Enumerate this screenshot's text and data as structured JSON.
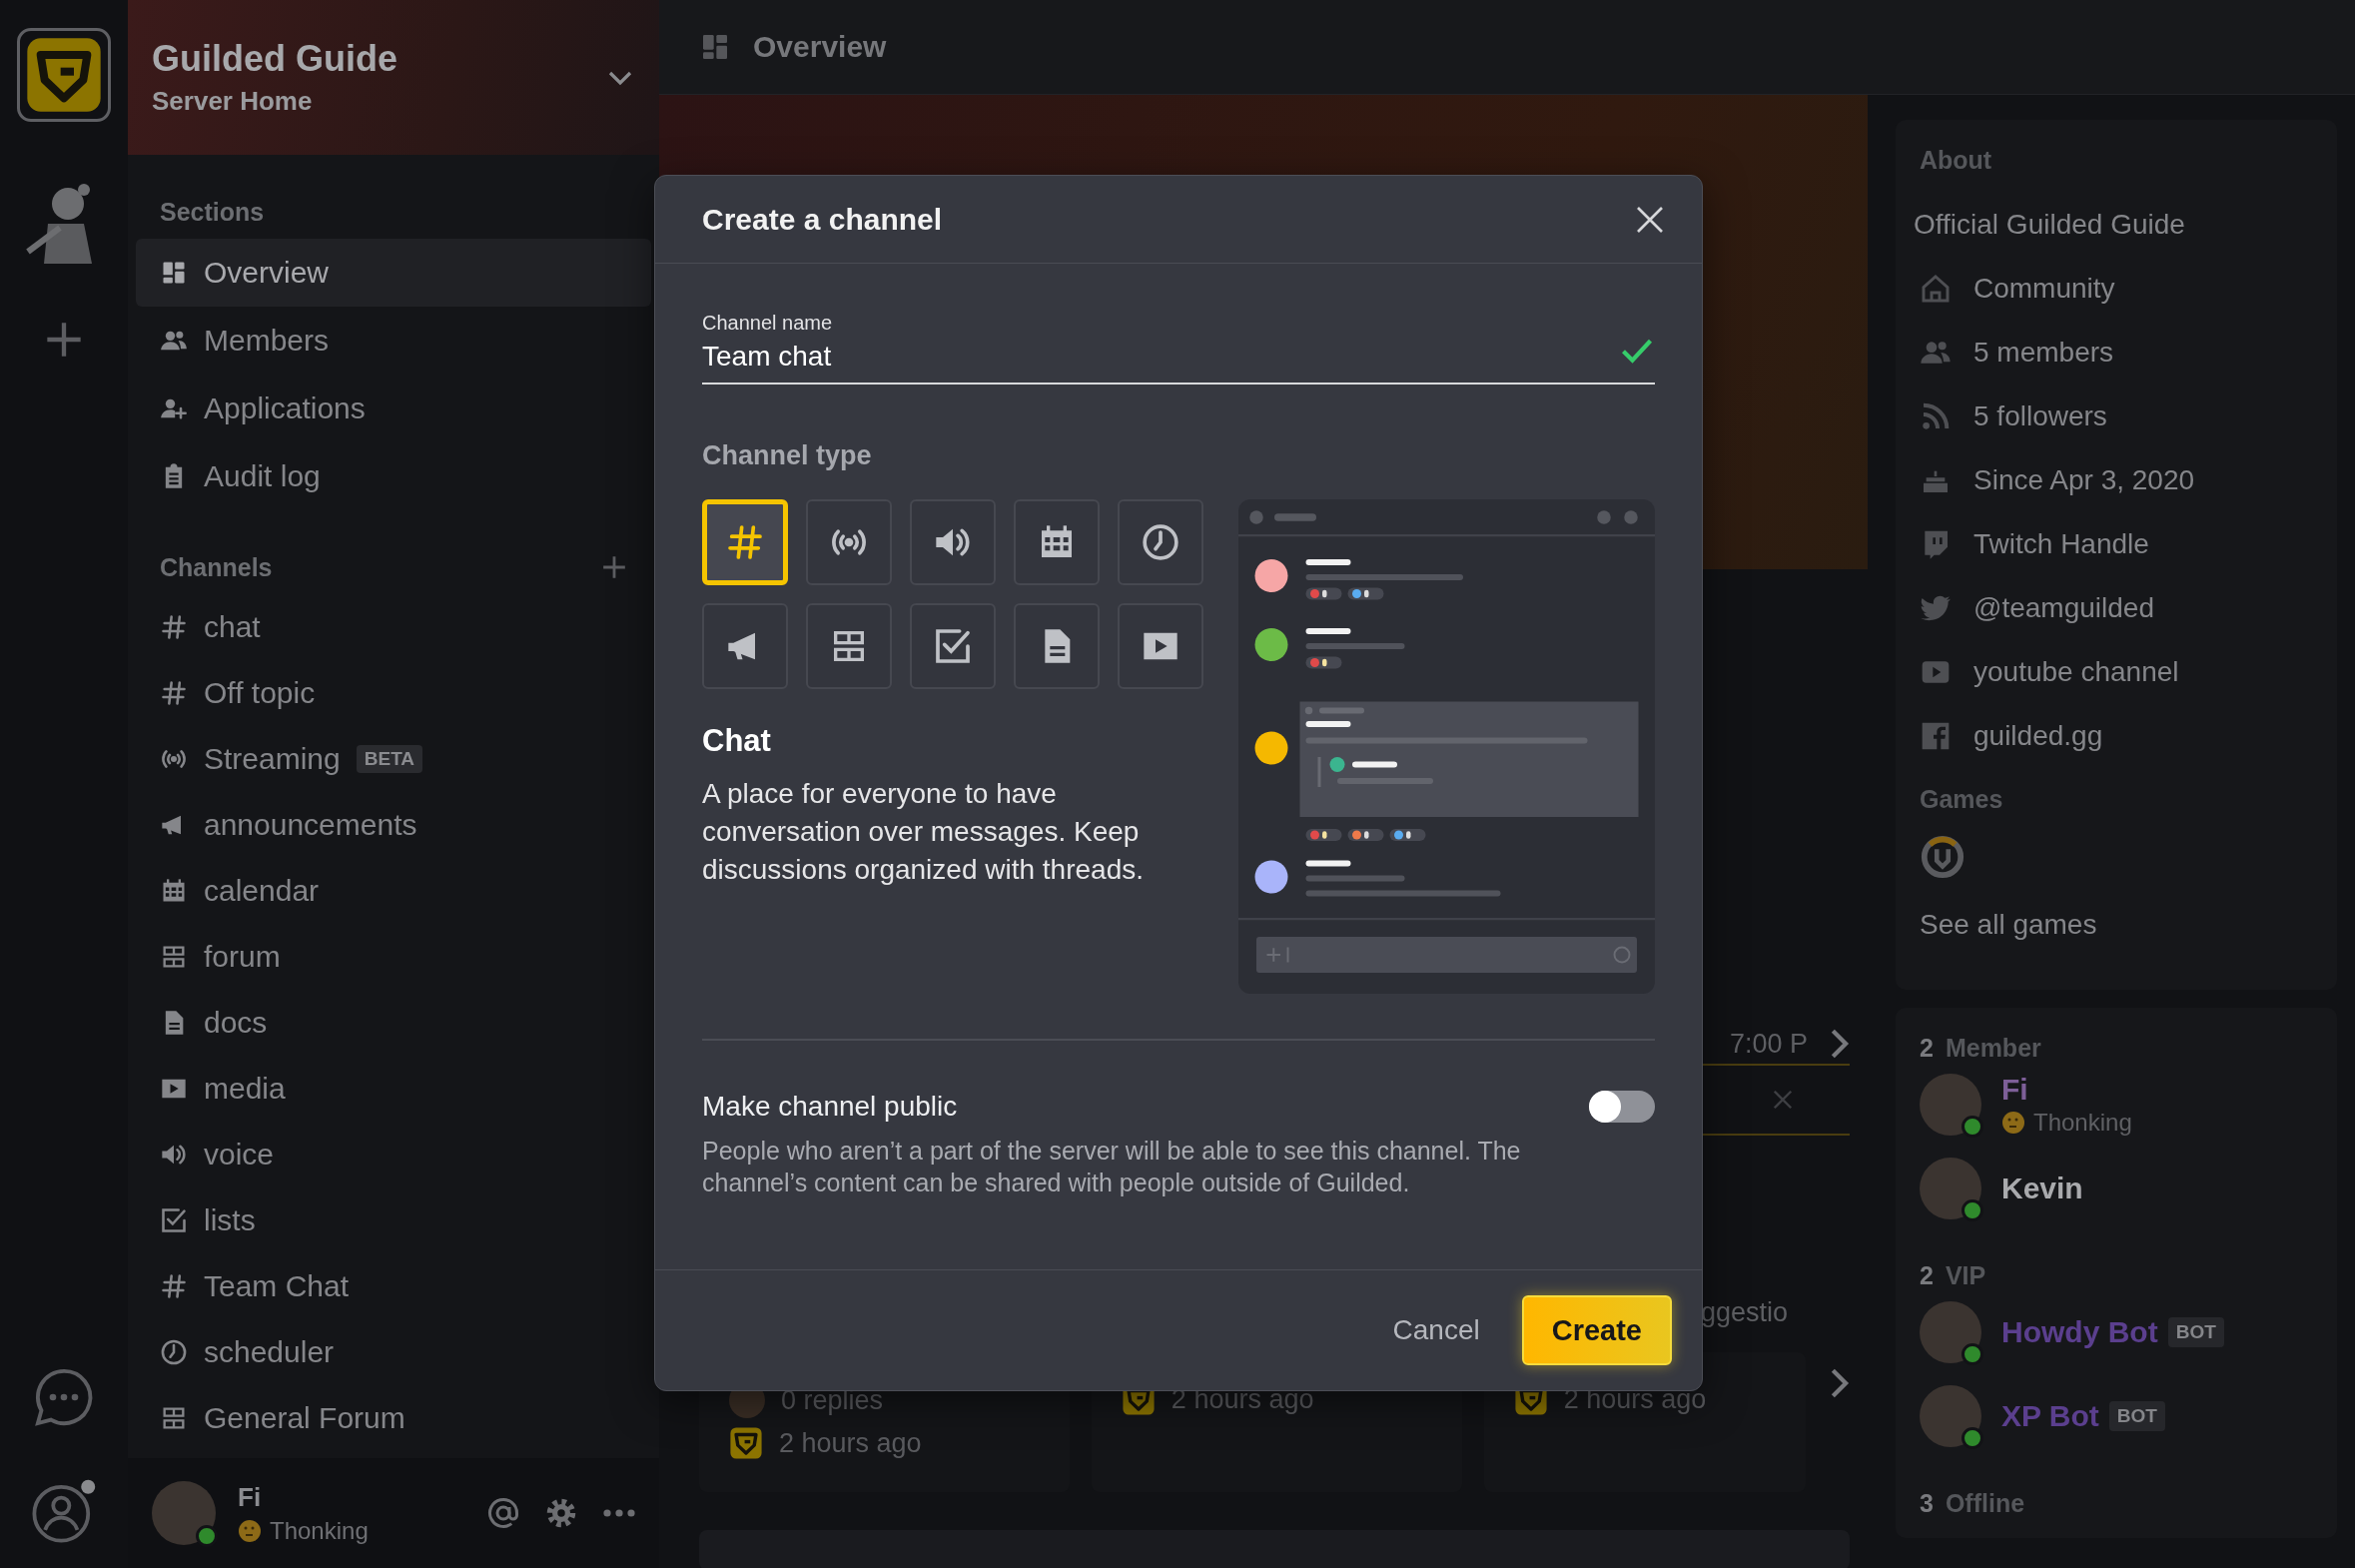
{
  "server": {
    "name": "Guilded Guide",
    "subtitle": "Server Home"
  },
  "sections": {
    "title": "Sections",
    "items": [
      {
        "label": "Overview",
        "kind": "overview",
        "selected": true
      },
      {
        "label": "Members",
        "kind": "members",
        "selected": false
      },
      {
        "label": "Applications",
        "kind": "applications",
        "selected": false
      },
      {
        "label": "Audit log",
        "kind": "audit",
        "selected": false
      }
    ]
  },
  "channels": {
    "title": "Channels",
    "items": [
      {
        "label": "chat",
        "kind": "chat",
        "selected": false
      },
      {
        "label": "Off topic",
        "kind": "chat",
        "selected": false
      },
      {
        "label": "Streaming",
        "kind": "stream",
        "badge": "BETA",
        "selected": false
      },
      {
        "label": "announcements",
        "kind": "announcement",
        "selected": false
      },
      {
        "label": "calendar",
        "kind": "calendar",
        "selected": false
      },
      {
        "label": "forum",
        "kind": "forum",
        "selected": false
      },
      {
        "label": "docs",
        "kind": "docs",
        "selected": false
      },
      {
        "label": "media",
        "kind": "media",
        "selected": false
      },
      {
        "label": "voice",
        "kind": "voice",
        "selected": false
      },
      {
        "label": "lists",
        "kind": "list",
        "selected": false
      },
      {
        "label": "Team Chat",
        "kind": "chat",
        "selected": false
      },
      {
        "label": "scheduler",
        "kind": "scheduling",
        "selected": false
      },
      {
        "label": "General Forum",
        "kind": "forum",
        "selected": false
      }
    ]
  },
  "user": {
    "name": "Fi",
    "status": "Thonking",
    "online": true
  },
  "main": {
    "title": "Overview",
    "event_time": "7:00 P",
    "suggestion": "ggestio",
    "cards": [
      {
        "replies": "0 replies",
        "time": "2 hours ago"
      },
      {
        "time": "2 hours ago"
      },
      {
        "time": "2 hours ago"
      }
    ]
  },
  "about": {
    "heading": "About",
    "title": "Official Guilded Guide",
    "items": [
      {
        "kind": "community",
        "label": "Community"
      },
      {
        "kind": "members",
        "label": "5 members"
      },
      {
        "kind": "followers",
        "label": "5 followers"
      },
      {
        "kind": "since",
        "label": "Since Apr 3, 2020"
      },
      {
        "kind": "twitch",
        "label": "Twitch Handle"
      },
      {
        "kind": "twitter",
        "label": "@teamguilded"
      },
      {
        "kind": "youtube",
        "label": "youtube channel"
      },
      {
        "kind": "website",
        "label": "guilded.gg"
      }
    ],
    "games_heading": "Games",
    "games_link": "See all games"
  },
  "member_groups": [
    {
      "count": "2",
      "title": "Member",
      "members": [
        {
          "name": "Fi",
          "status": "Thonking",
          "online": true,
          "color": "#7d5f98"
        },
        {
          "name": "Kevin",
          "online": true,
          "color": "#a9aaad"
        }
      ]
    },
    {
      "count": "2",
      "title": "VIP",
      "members": [
        {
          "name": "Howdy Bot",
          "badge": "BOT",
          "online": true,
          "color": "#5b3f8e"
        },
        {
          "name": "XP Bot",
          "badge": "BOT",
          "online": true,
          "color": "#5b3f8e"
        }
      ]
    },
    {
      "count": "3",
      "title": "Offline"
    }
  ],
  "modal": {
    "title": "Create a channel",
    "name_field": {
      "label": "Channel name",
      "value": "Team chat",
      "valid": true
    },
    "type_heading": "Channel type",
    "types": [
      {
        "kind": "chat",
        "selected": true
      },
      {
        "kind": "stream",
        "selected": false
      },
      {
        "kind": "voice",
        "selected": false
      },
      {
        "kind": "calendar",
        "selected": false
      },
      {
        "kind": "scheduling",
        "selected": false
      },
      {
        "kind": "announcement",
        "selected": false
      },
      {
        "kind": "forum",
        "selected": false
      },
      {
        "kind": "list",
        "selected": false
      },
      {
        "kind": "docs",
        "selected": false
      },
      {
        "kind": "media",
        "selected": false
      }
    ],
    "type_title": "Chat",
    "type_description": "A place for everyone to have conversation over messages. Keep discussions organized with threads.",
    "public": {
      "label": "Make channel public",
      "description": "People who aren’t a part of the server will be able to see this channel. The channel’s content can be shared with people outside of Guilded.",
      "on": false
    },
    "cancel": "Cancel",
    "create": "Create"
  }
}
